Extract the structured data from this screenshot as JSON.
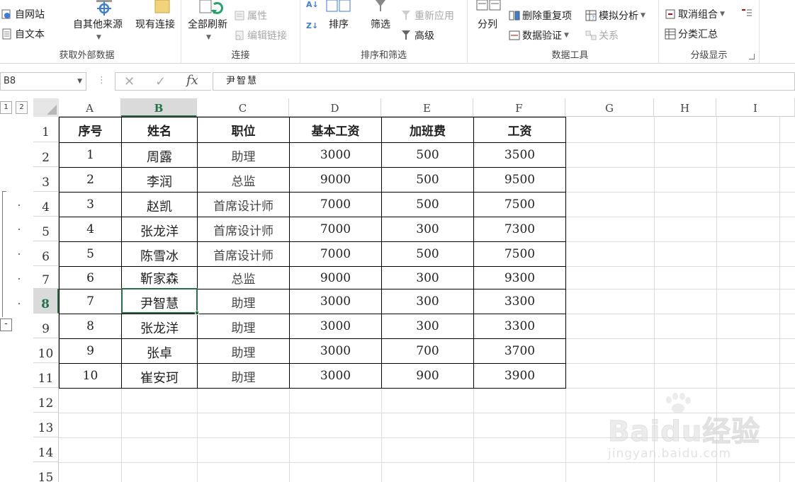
{
  "ribbon": {
    "get_external": {
      "group_label": "获取外部数据",
      "from_web": "自网站",
      "from_text": "自文本",
      "from_other": "自其他来源",
      "existing": "现有连接"
    },
    "connections": {
      "group_label": "连接",
      "refresh_all": "全部刷新",
      "properties": "属性",
      "edit_links": "编辑链接"
    },
    "sort_filter": {
      "group_label": "排序和筛选",
      "sort": "排序",
      "filter": "筛选",
      "reapply": "重新应用",
      "advanced": "高级"
    },
    "data_tools": {
      "group_label": "数据工具",
      "text_to_columns": "分列",
      "remove_dup": "删除重复项",
      "validation": "数据验证",
      "what_if": "模拟分析",
      "relationships": "关系"
    },
    "outline": {
      "group_label": "分级显示",
      "ungroup": "取消组合",
      "subtotal": "分类汇总"
    }
  },
  "formula_bar": {
    "name_box": "B8",
    "content": "尹智慧"
  },
  "outline_levels": [
    "1",
    "2"
  ],
  "collapse_symbol": "-",
  "columns": [
    "A",
    "B",
    "C",
    "D",
    "E",
    "F",
    "G",
    "H",
    "I"
  ],
  "rows": [
    "1",
    "2",
    "3",
    "4",
    "5",
    "6",
    "7",
    "8",
    "9",
    "10",
    "11",
    "12",
    "13",
    "14",
    "15"
  ],
  "table": {
    "headers": [
      "序号",
      "姓名",
      "职位",
      "基本工资",
      "加班费",
      "工资"
    ],
    "records": [
      [
        "1",
        "周露",
        "助理",
        "3000",
        "500",
        "3500"
      ],
      [
        "2",
        "李润",
        "总监",
        "9000",
        "500",
        "9500"
      ],
      [
        "3",
        "赵凯",
        "首席设计师",
        "7000",
        "500",
        "7500"
      ],
      [
        "4",
        "张龙洋",
        "首席设计师",
        "7000",
        "300",
        "7300"
      ],
      [
        "5",
        "陈雪冰",
        "首席设计师",
        "7000",
        "500",
        "7500"
      ],
      [
        "6",
        "靳家森",
        "总监",
        "9000",
        "300",
        "9300"
      ],
      [
        "7",
        "尹智慧",
        "助理",
        "3000",
        "300",
        "3300"
      ],
      [
        "8",
        "张龙洋",
        "助理",
        "3000",
        "300",
        "3300"
      ],
      [
        "9",
        "张卓",
        "助理",
        "3000",
        "700",
        "3700"
      ],
      [
        "10",
        "崔安珂",
        "助理",
        "3000",
        "900",
        "3900"
      ]
    ]
  },
  "selected_cell": "B8",
  "watermark": {
    "logo": "Baidu经验",
    "url": "jingyan.baidu.com"
  },
  "colors": {
    "accent": "#217346",
    "header_bg": "#dadada",
    "gridline": "#dcdcdc"
  }
}
